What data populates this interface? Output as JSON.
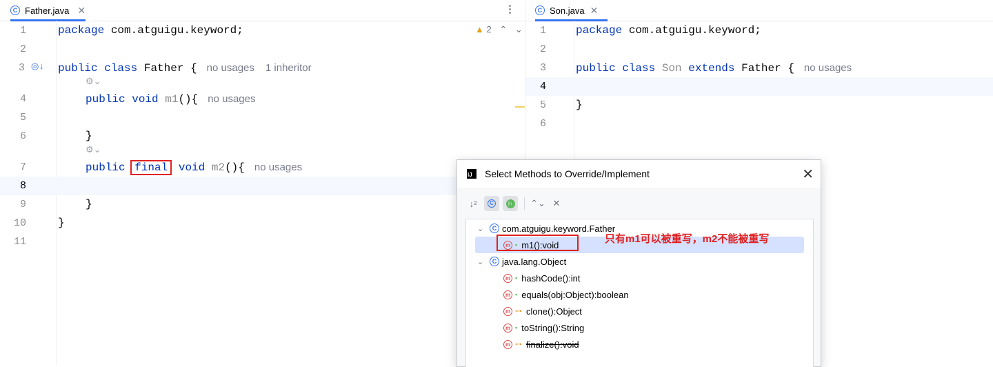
{
  "left_editor": {
    "tab_label": "Father.java",
    "warnings_count": "2",
    "inlay": {
      "no_usages": "no usages",
      "inheritor": "1 inheritor"
    },
    "code": {
      "package_kw": "package",
      "package_name": "com.atguigu.keyword;",
      "public_kw": "public",
      "class_kw": "class",
      "class_name": "Father",
      "brace_open": "{",
      "void_kw": "void",
      "m1_name": "m1",
      "parens_brace": "(){",
      "brace_close": "}",
      "final_kw": "final",
      "m2_name": "m2"
    },
    "line_numbers": [
      "1",
      "2",
      "3",
      "4",
      "5",
      "6",
      "7",
      "8",
      "9",
      "10",
      "11"
    ]
  },
  "right_editor": {
    "tab_label": "Son.java",
    "code": {
      "package_kw": "package",
      "package_name": "com.atguigu.keyword;",
      "public_kw": "public",
      "class_kw": "class",
      "class_name": "Son",
      "extends_kw": "extends",
      "parent_name": "Father",
      "brace_open": "{",
      "brace_close": "}"
    },
    "inlay_no_usages": "no usages",
    "line_numbers": [
      "1",
      "2",
      "3",
      "4",
      "5",
      "6"
    ]
  },
  "dialog": {
    "title": "Select Methods to Override/Implement",
    "tree": {
      "group1": "com.atguigu.keyword.Father",
      "group1_items": [
        "m1():void"
      ],
      "group2": "java.lang.Object",
      "group2_items": [
        "hashCode():int",
        "equals(obj:Object):boolean",
        "clone():Object",
        "toString():String",
        "finalize():void"
      ]
    }
  },
  "annotation": "只有m1可以被重写，m2不能被重写",
  "colors": {
    "keyword": "#0033b3",
    "accent": "#3574f0",
    "highlight": "#e02020",
    "selection": "#d5e1ff"
  }
}
